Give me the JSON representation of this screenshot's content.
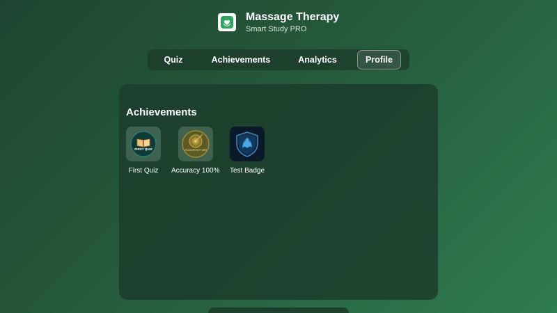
{
  "app": {
    "title": "Massage Therapy",
    "subtitle": "Smart Study PRO",
    "logo_icon": "hand-heart-icon"
  },
  "nav": {
    "tabs": [
      {
        "label": "Quiz",
        "active": false
      },
      {
        "label": "Achievements",
        "active": false
      },
      {
        "label": "Analytics",
        "active": false
      },
      {
        "label": "Profile",
        "active": true
      }
    ]
  },
  "achievements": {
    "heading": "Achievements",
    "badges": [
      {
        "label": "First Quiz",
        "icon": "open-book-badge-icon",
        "badge_text": "FIRST QUIZ"
      },
      {
        "label": "Accuracy 100%",
        "icon": "target-medal-badge-icon",
        "badge_text": "ACCURACY 100"
      },
      {
        "label": "Test Badge",
        "icon": "shield-flex-badge-icon"
      }
    ]
  },
  "colors": {
    "background_start": "#1f4531",
    "background_end": "#2e7c4f",
    "panel": "#1c3c2b",
    "logo_accent": "#2ca55a"
  }
}
